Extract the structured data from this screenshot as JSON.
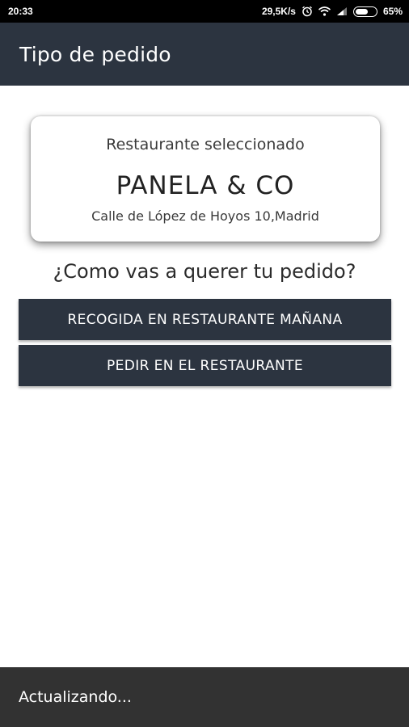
{
  "status_bar": {
    "time": "20:33",
    "network_speed": "29,5K/s",
    "battery_percent": "65%",
    "battery_level": 0.65,
    "icons": [
      "alarm-icon",
      "wifi-icon",
      "signal-icon",
      "battery-icon"
    ]
  },
  "app_bar": {
    "title": "Tipo de pedido"
  },
  "restaurant_card": {
    "label": "Restaurante seleccionado",
    "name": "PANELA & CO",
    "address": "Calle de López de Hoyos 10,Madrid"
  },
  "order_question": "¿Como vas a querer tu pedido?",
  "options": [
    {
      "label": "RECOGIDA EN RESTAURANTE MAÑANA"
    },
    {
      "label": "PEDIR EN EL RESTAURANTE"
    }
  ],
  "snackbar": {
    "message": "Actualizando..."
  },
  "colors": {
    "primary": "#2c3440",
    "status_bar": "#000000",
    "snackbar": "#323232",
    "background": "#ffffff"
  }
}
